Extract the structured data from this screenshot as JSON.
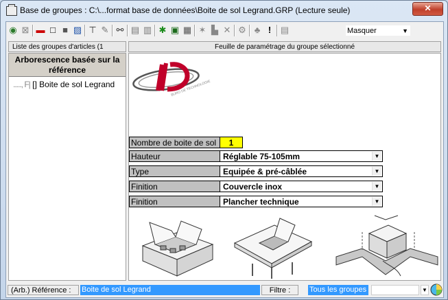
{
  "window": {
    "title": "Base de groupes : C:\\...format base de données\\Boite de sol Legrand.GRP (Lecture seule)",
    "close_label": "✕"
  },
  "toolbar": {
    "combo_value": "Masquer",
    "icons": [
      "globe-icon",
      "grid-icon",
      "minus-icon",
      "window-icon",
      "pen-icon",
      "chart-icon",
      "tree-icon",
      "edit-icon",
      "binoculars-icon",
      "filter-icon",
      "compare-icon",
      "tree-add-icon",
      "image-icon",
      "tree-compare-icon",
      "new-icon",
      "copy-icon",
      "delete-icon",
      "gear-icon",
      "key-icon",
      "exclamation-icon",
      "table-icon"
    ]
  },
  "left": {
    "header": "Liste des groupes d'articles (1",
    "tree_title_line1": "Arborescence basée sur la",
    "tree_title_line2": "référence",
    "tree_item": "[] Boite de sol Legrand",
    "tree_prefix": "....., F|"
  },
  "right": {
    "header": "Feuille de paramétrage du groupe sélectionné",
    "rows": [
      {
        "label": "Nombre de boite de sol",
        "value": "1"
      },
      {
        "label": "Hauteur",
        "value": "Réglable 75-105mm"
      },
      {
        "label": "Type",
        "value": "Equipée & pré-câblée"
      },
      {
        "label": "Finition",
        "value": "Couvercle inox"
      },
      {
        "label": "Finition",
        "value": "Plancher technique"
      }
    ],
    "logo_text": "BURO DE TECHNOLOGIE"
  },
  "status": {
    "ref_label": "(Arb.) Référence :",
    "ref_value": "Boite de sol Legrand",
    "filter_label": "Filtre :",
    "filter_value": "Tous les groupes"
  }
}
